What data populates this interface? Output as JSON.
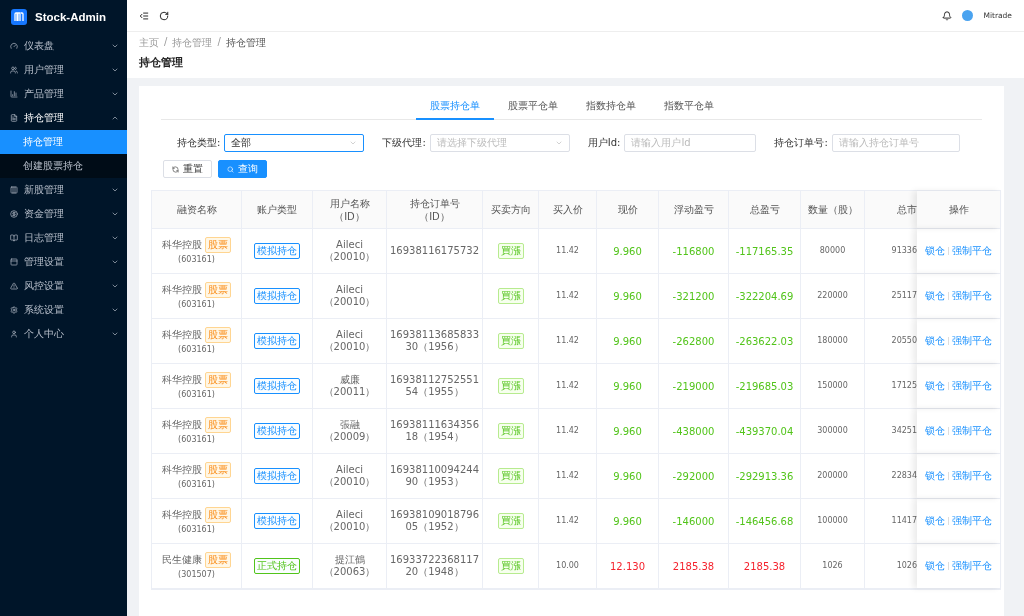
{
  "brand": "Stock-Admin",
  "sidebar": {
    "items": [
      {
        "label": "仪表盘",
        "expanded": false
      },
      {
        "label": "用户管理",
        "expanded": false
      },
      {
        "label": "产品管理",
        "expanded": false
      },
      {
        "label": "持仓管理",
        "expanded": true,
        "children": [
          {
            "label": "持仓管理",
            "selected": true
          },
          {
            "label": "创建股票持仓",
            "selected": false
          }
        ]
      },
      {
        "label": "新股管理",
        "expanded": false
      },
      {
        "label": "资金管理",
        "expanded": false
      },
      {
        "label": "日志管理",
        "expanded": false
      },
      {
        "label": "管理设置",
        "expanded": false
      },
      {
        "label": "风控设置",
        "expanded": false
      },
      {
        "label": "系统设置",
        "expanded": false
      },
      {
        "label": "个人中心",
        "expanded": false
      }
    ]
  },
  "header": {
    "user": "Mitrade"
  },
  "breadcrumb": {
    "separator": "/",
    "items": [
      "主页",
      "持仓管理",
      "持仓管理"
    ]
  },
  "page_title": "持仓管理",
  "tabs": [
    {
      "label": "股票持仓单",
      "selected": true
    },
    {
      "label": "股票平仓单",
      "selected": false
    },
    {
      "label": "指数持仓单",
      "selected": false
    },
    {
      "label": "指数平仓单",
      "selected": false
    }
  ],
  "filters": [
    {
      "label": "持仓类型:",
      "kind": "select",
      "value": "全部"
    },
    {
      "label": "下级代理:",
      "kind": "select",
      "placeholder": "请选择下级代理"
    },
    {
      "label": "用户Id:",
      "kind": "input",
      "placeholder": "请输入用户Id"
    },
    {
      "label": "持仓订单号:",
      "kind": "input",
      "placeholder": "请输入持仓订单号"
    }
  ],
  "buttons": {
    "reset": "重置",
    "search": "查询"
  },
  "table": {
    "columns": [
      "融资名称",
      "账户类型",
      "用户名称（ID）",
      "持仓订单号（ID）",
      "买卖方向",
      "买入价",
      "现价",
      "浮动盈亏",
      "总盈亏",
      "数量（股）",
      "总市",
      "操作"
    ],
    "rows": [
      {
        "name": "科华控股",
        "code": "(603161)",
        "tag": "股票",
        "account": {
          "label": "模拟持仓",
          "color": "#1890ff"
        },
        "user": "Aileci（20010）",
        "order": "16938116175732",
        "direction": "買漲",
        "buy": "11.42",
        "pnl": {
          "price": "9.960",
          "float": "-116800",
          "total": "-117165.35",
          "color": "#52c41a"
        },
        "qty": "80000",
        "mv": "91336",
        "actions": [
          "锁仓",
          "强制平仓"
        ]
      },
      {
        "name": "科华控股",
        "code": "(603161)",
        "tag": "股票",
        "account": {
          "label": "模拟持仓",
          "color": "#1890ff"
        },
        "user": "Aileci（20010）",
        "direction": "買漲",
        "buy": "11.42",
        "pnl": {
          "price": "9.960",
          "float": "-321200",
          "total": "-322204.69",
          "color": "#52c41a"
        },
        "qty": "220000",
        "mv": "25117",
        "actions": [
          "锁仓",
          "强制平仓"
        ]
      },
      {
        "name": "科华控股",
        "code": "(603161)",
        "tag": "股票",
        "account": {
          "label": "模拟持仓",
          "color": "#1890ff"
        },
        "user": "Aileci（20010）",
        "order": "1693811368583330（1956）",
        "direction": "買漲",
        "buy": "11.42",
        "pnl": {
          "price": "9.960",
          "float": "-262800",
          "total": "-263622.03",
          "color": "#52c41a"
        },
        "qty": "180000",
        "mv": "20550",
        "actions": [
          "锁仓",
          "强制平仓"
        ]
      },
      {
        "name": "科华控股",
        "code": "(603161)",
        "tag": "股票",
        "account": {
          "label": "模拟持仓",
          "color": "#1890ff"
        },
        "user": "威廉（20011）",
        "order": "1693811275255154（1955）",
        "direction": "買漲",
        "buy": "11.42",
        "pnl": {
          "price": "9.960",
          "float": "-219000",
          "total": "-219685.03",
          "color": "#52c41a"
        },
        "qty": "150000",
        "mv": "17125",
        "actions": [
          "锁仓",
          "强制平仓"
        ]
      },
      {
        "name": "科华控股",
        "code": "(603161)",
        "tag": "股票",
        "account": {
          "label": "模拟持仓",
          "color": "#1890ff"
        },
        "user": "張融（20009）",
        "order": "1693811163435618（1954）",
        "direction": "買漲",
        "buy": "11.42",
        "pnl": {
          "price": "9.960",
          "float": "-438000",
          "total": "-439370.04",
          "color": "#52c41a"
        },
        "qty": "300000",
        "mv": "34251",
        "actions": [
          "锁仓",
          "强制平仓"
        ]
      },
      {
        "name": "科华控股",
        "code": "(603161)",
        "tag": "股票",
        "account": {
          "label": "模拟持仓",
          "color": "#1890ff"
        },
        "user": "Aileci（20010）",
        "order": "1693811009424490（1953）",
        "direction": "買漲",
        "buy": "11.42",
        "pnl": {
          "price": "9.960",
          "float": "-292000",
          "total": "-292913.36",
          "color": "#52c41a"
        },
        "qty": "200000",
        "mv": "22834",
        "actions": [
          "锁仓",
          "强制平仓"
        ]
      },
      {
        "name": "科华控股",
        "code": "(603161)",
        "tag": "股票",
        "account": {
          "label": "模拟持仓",
          "color": "#1890ff"
        },
        "user": "Aileci（20010）",
        "order": "1693810901879605（1952）",
        "direction": "買漲",
        "buy": "11.42",
        "pnl": {
          "price": "9.960",
          "float": "-146000",
          "total": "-146456.68",
          "color": "#52c41a"
        },
        "qty": "100000",
        "mv": "11417",
        "actions": [
          "锁仓",
          "强制平仓"
        ]
      },
      {
        "name": "民生健康",
        "code": "(301507)",
        "tag": "股票",
        "account": {
          "label": "正式持仓",
          "color": "#52c41a"
        },
        "user": "提江鶴（20063）",
        "order": "1693372236811720（1948）",
        "direction": "買漲",
        "buy": "10.00",
        "pnl": {
          "price": "12.130",
          "float": "2185.38",
          "total": "2185.38",
          "color": "#f5222d"
        },
        "qty": "1026",
        "mv": "1026",
        "actions": [
          "锁仓",
          "强制平仓"
        ]
      }
    ]
  }
}
